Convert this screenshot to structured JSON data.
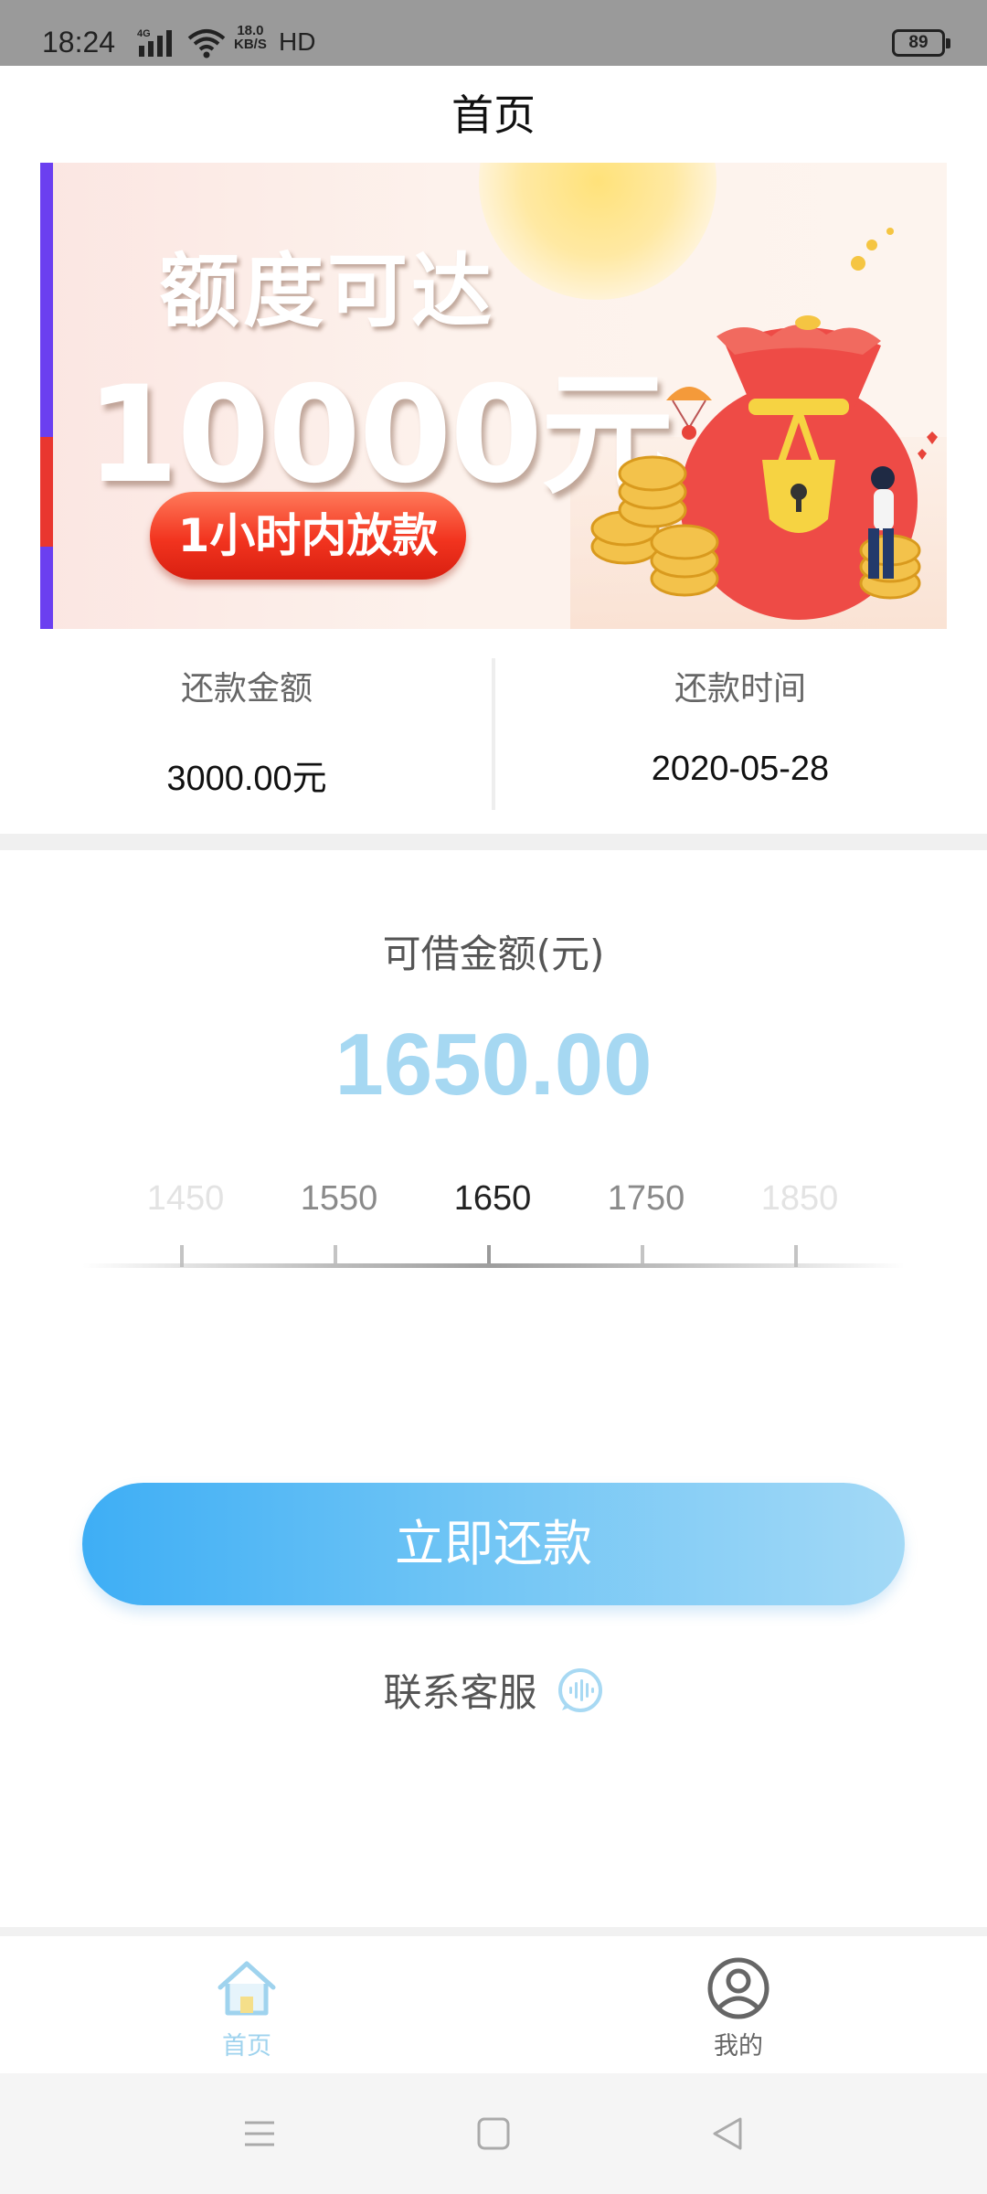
{
  "status_bar": {
    "time": "18:24",
    "network": "4G",
    "speed_value": "18.0",
    "speed_unit": "KB/S",
    "hd": "HD",
    "battery": "89"
  },
  "header": {
    "title": "首页"
  },
  "banner": {
    "headline": "额度可达",
    "amount": "10000元",
    "pill": "1小时内放款"
  },
  "repayment": {
    "amount_label": "还款金额",
    "amount_value": "3000.00元",
    "date_label": "还款时间",
    "date_value": "2020-05-28"
  },
  "loan": {
    "label": "可借金额(元)",
    "amount": "1650.00",
    "ruler_ticks": [
      "1450",
      "1550",
      "1650",
      "1750",
      "1850"
    ],
    "selected": "1650"
  },
  "actions": {
    "repay_button": "立即还款",
    "support": "联系客服"
  },
  "tabbar": {
    "home": "首页",
    "mine": "我的"
  },
  "colors": {
    "accent": "#3eaef5",
    "amount": "#a6d8f2",
    "active_tab": "#9fd3ee",
    "inactive_tab": "#666666"
  }
}
